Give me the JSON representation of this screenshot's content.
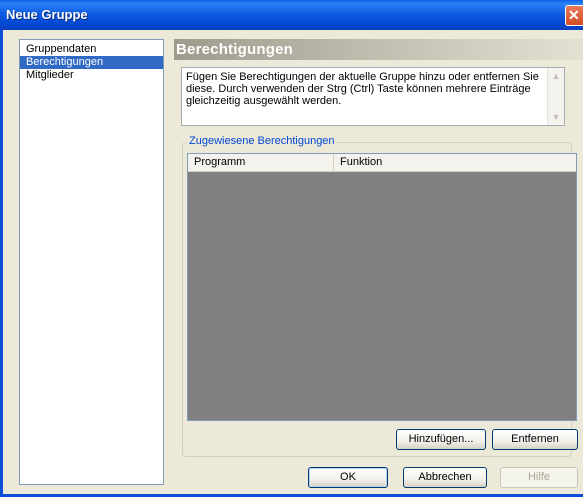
{
  "window": {
    "title": "Neue Gruppe"
  },
  "sidebar": {
    "items": [
      {
        "label": "Gruppendaten"
      },
      {
        "label": "Berechtigungen",
        "selected": true
      },
      {
        "label": "Mitglieder"
      }
    ]
  },
  "panel": {
    "title": "Berechtigungen",
    "description": "Fügen Sie Berechtigungen der aktuelle Gruppe hinzu oder entfernen Sie diese. Durch verwenden der Strg (Ctrl) Taste können mehrere Einträge gleichzeitig ausgewählt werden."
  },
  "permissions": {
    "group_label": "Zugewiesene Berechtigungen",
    "columns": [
      "Programm",
      "Funktion"
    ],
    "rows": [],
    "add_label": "Hinzufügen...",
    "remove_label": "Entfernen"
  },
  "footer": {
    "ok_label": "OK",
    "cancel_label": "Abbrechen",
    "help_label": "Hilfe"
  },
  "colors": {
    "selection": "#316AC5",
    "title_bar": "#0A5FE6",
    "list_background": "#808080",
    "group_label": "#0046D5"
  },
  "icons": {
    "close": "close-icon",
    "scroll_up": "scroll-up-arrow-icon",
    "scroll_down": "scroll-down-arrow-icon"
  }
}
